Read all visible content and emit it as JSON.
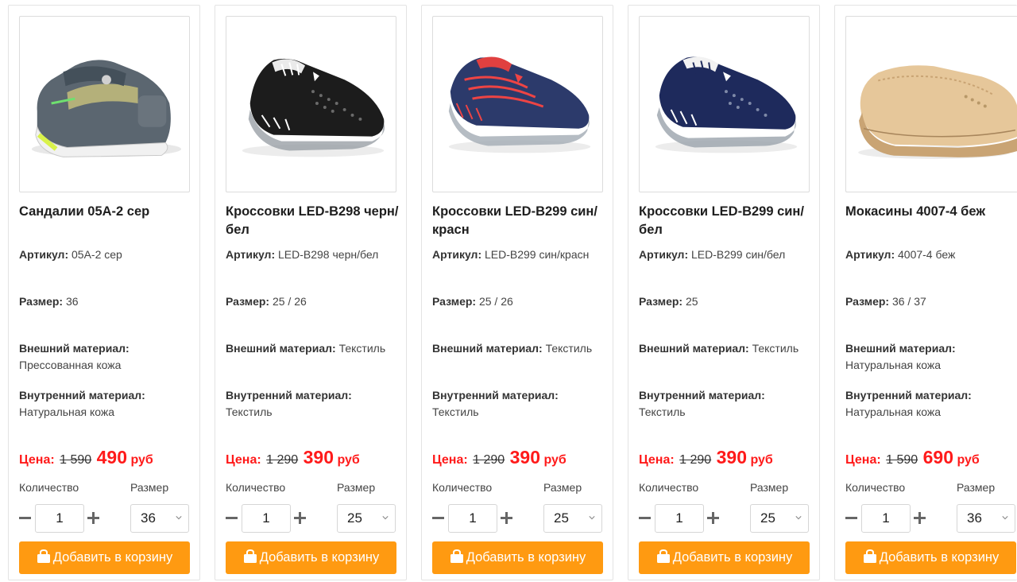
{
  "labels": {
    "article": "Артикул:",
    "size": "Размер:",
    "outer_material": "Внешний материал:",
    "inner_material": "Внутренний материал:",
    "price": "Цена:",
    "currency": "руб",
    "quantity": "Количество",
    "size_select": "Размер",
    "add_to_cart": "Добавить в корзину"
  },
  "icons": {
    "cart": "shopping-bag-icon",
    "minus": "minus-icon",
    "plus": "plus-icon",
    "dropdown": "chevron-down-icon"
  },
  "colors": {
    "accent": "#ff9a11",
    "price": "#ff1a1a"
  },
  "products": [
    {
      "title": "Сандалии 05A-2 сер",
      "article": "05A-2 сер",
      "size": "36",
      "outer_material": "Прессованная кожа",
      "inner_material": "Натуральная кожа",
      "old_price": "1 590",
      "new_price": "490",
      "quantity": "1",
      "selected_size": "36"
    },
    {
      "title": "Кроссовки LED-B298 черн/бел",
      "article": "LED-B298 черн/бел",
      "size": "25 / 26",
      "outer_material": "Текстиль",
      "inner_material": "Текстиль",
      "old_price": "1 290",
      "new_price": "390",
      "quantity": "1",
      "selected_size": "25"
    },
    {
      "title": "Кроссовки LED-B299 син/красн",
      "article": "LED-B299 син/красн",
      "size": "25 / 26",
      "outer_material": "Текстиль",
      "inner_material": "Текстиль",
      "old_price": "1 290",
      "new_price": "390",
      "quantity": "1",
      "selected_size": "25"
    },
    {
      "title": "Кроссовки LED-B299 син/бел",
      "article": "LED-B299 син/бел",
      "size": "25",
      "outer_material": "Текстиль",
      "inner_material": "Текстиль",
      "old_price": "1 290",
      "new_price": "390",
      "quantity": "1",
      "selected_size": "25"
    },
    {
      "title": "Мокасины 4007-4 беж",
      "article": "4007-4 беж",
      "size": "36 / 37",
      "outer_material": "Натуральная кожа",
      "inner_material": "Натуральная кожа",
      "old_price": "1 590",
      "new_price": "690",
      "quantity": "1",
      "selected_size": "36"
    }
  ]
}
